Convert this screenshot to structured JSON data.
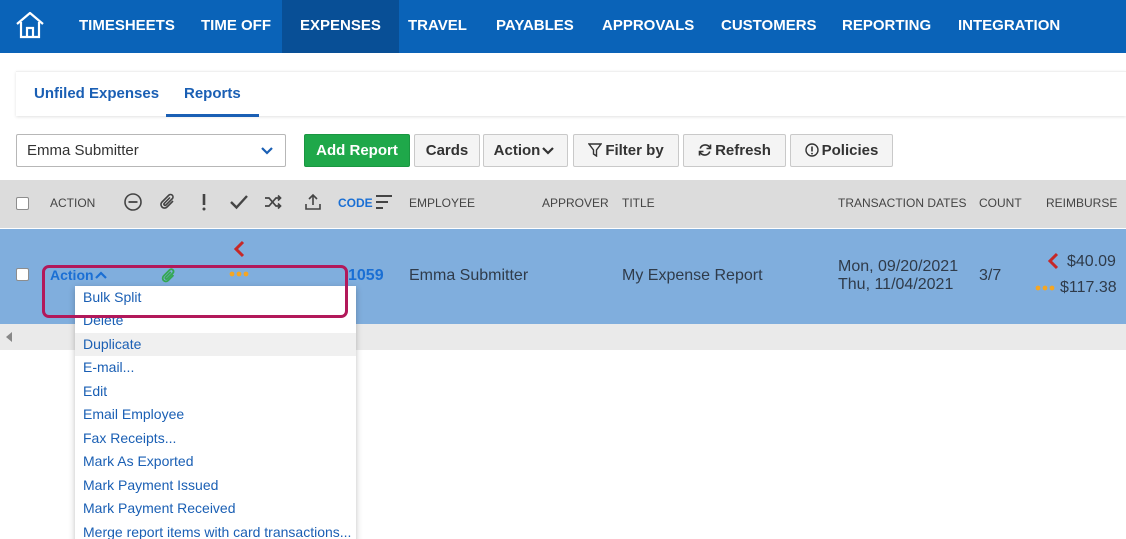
{
  "nav": {
    "items": [
      "TIMESHEETS",
      "TIME OFF",
      "EXPENSES",
      "TRAVEL",
      "PAYABLES",
      "APPROVALS",
      "CUSTOMERS",
      "REPORTING",
      "INTEGRATION"
    ],
    "active": "EXPENSES",
    "home_icon": "home-icon"
  },
  "subtabs": [
    "Unfiled Expenses",
    "Reports"
  ],
  "subtab_active": "Reports",
  "toolbar": {
    "employee_select_value": "Emma Submitter",
    "add_report": "Add Report",
    "cards": "Cards",
    "action": "Action",
    "filter_by": "Filter by",
    "refresh": "Refresh",
    "policies": "Policies"
  },
  "table": {
    "headers": {
      "action": "ACTION",
      "code": "CODE",
      "employee": "EMPLOYEE",
      "approver": "APPROVER",
      "title": "TITLE",
      "transaction_dates": "TRANSACTION DATES",
      "count": "COUNT",
      "reimburse": "REIMBURSE"
    },
    "header_icons": [
      "minus-circle-icon",
      "paperclip-icon",
      "exclamation-icon",
      "checkmark-icon",
      "shuffle-icon",
      "upload-icon",
      "sort-icon"
    ],
    "rows": [
      {
        "action": "Action",
        "code": "1059",
        "employee": "Emma Submitter",
        "approver": "",
        "title": "My Expense Report",
        "date_start": "Mon, 09/20/2021",
        "date_end": "Thu, 11/04/2021",
        "count": "3/7",
        "reimburse_primary": "$40.09",
        "reimburse_secondary": "$117.38"
      }
    ]
  },
  "menu": {
    "items": [
      "Bulk Split",
      "Delete",
      "Duplicate",
      "E-mail...",
      "Edit",
      "Email Employee",
      "Fax Receipts...",
      "Mark As Exported",
      "Mark Payment Issued",
      "Mark Payment Received",
      "Merge report items with card transactions..."
    ],
    "hovered": "Duplicate"
  },
  "colors": {
    "nav_bg": "#0a63b8",
    "nav_active": "#084f96",
    "row_selected": "#80aedd",
    "accent_green": "#1fa84a",
    "highlight": "#b2185a",
    "link_blue": "#1a5fb4"
  }
}
